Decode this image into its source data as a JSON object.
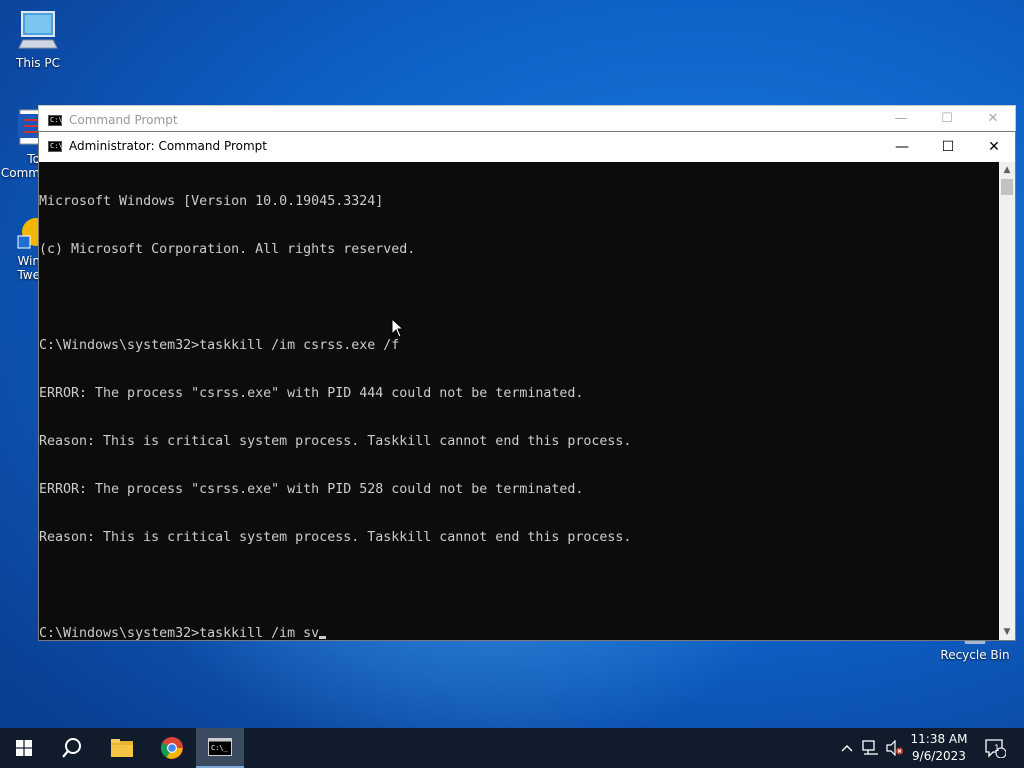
{
  "desktop": {
    "icons": [
      {
        "label": "This PC"
      },
      {
        "label": "To Comm"
      },
      {
        "label": "Win Twe"
      },
      {
        "label": "Recycle Bin"
      }
    ]
  },
  "back_window": {
    "title": "Command Prompt"
  },
  "window": {
    "title": "Administrator: Command Prompt",
    "console_lines": [
      "Microsoft Windows [Version 10.0.19045.3324]",
      "(c) Microsoft Corporation. All rights reserved.",
      "",
      "C:\\Windows\\system32>taskkill /im csrss.exe /f",
      "ERROR: The process \"csrss.exe\" with PID 444 could not be terminated.",
      "Reason: This is critical system process. Taskkill cannot end this process.",
      "ERROR: The process \"csrss.exe\" with PID 528 could not be terminated.",
      "Reason: This is critical system process. Taskkill cannot end this process.",
      "",
      "C:\\Windows\\system32>taskkill /im sv"
    ]
  },
  "taskbar": {
    "items": [
      "start-icon",
      "search-icon",
      "file-explorer-icon",
      "chrome-icon",
      "command-prompt-icon"
    ],
    "clock": {
      "time": "11:38 AM",
      "date": "9/6/2023"
    },
    "notification_count": "1",
    "colors": {
      "taskbar_bg": "#101c2b",
      "active_bg": "#3a4b60"
    }
  }
}
